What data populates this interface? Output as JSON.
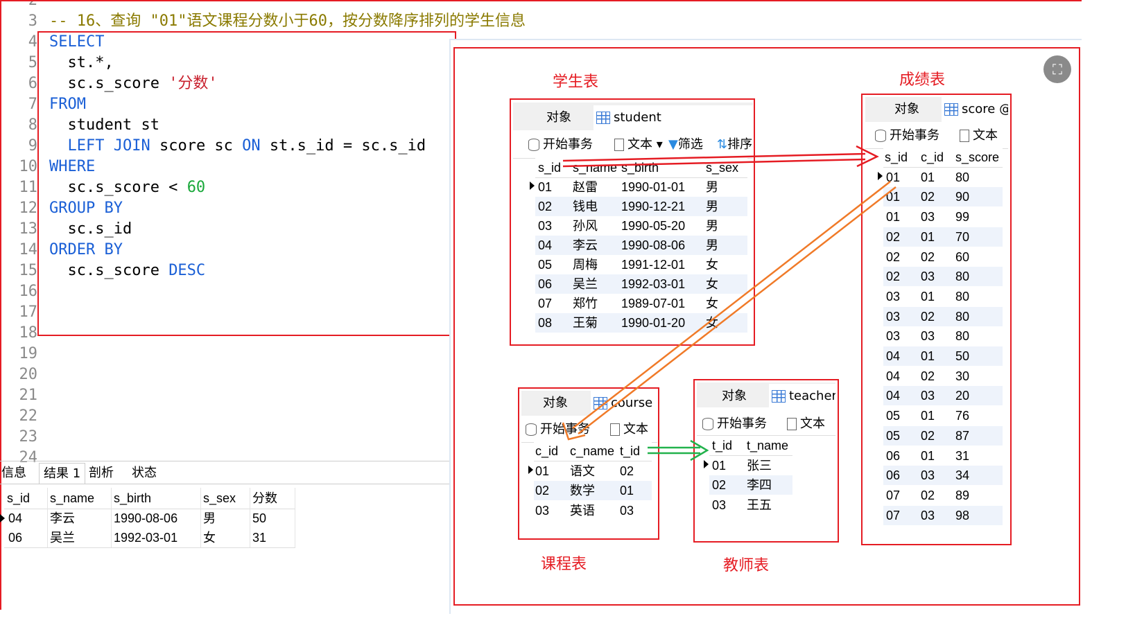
{
  "editor": {
    "lines": [
      "2",
      "3",
      "4",
      "5",
      "6",
      "7",
      "8",
      "9",
      "10",
      "11",
      "12",
      "13",
      "14",
      "15",
      "16",
      "17",
      "18",
      "19",
      "20",
      "21",
      "22",
      "23",
      "24"
    ],
    "comment": "-- 16、查询 \"01\"语文课程分数小于60，按分数降序排列的学生信息",
    "sql": {
      "l4": "SELECT",
      "l5": "  st.*,",
      "l6a": "  sc.s_score ",
      "l6b": "'分数'",
      "l7": "FROM",
      "l8": "  student st",
      "l9a": "  ",
      "l9b": "LEFT JOIN",
      "l9c": " score sc ",
      "l9d": "ON",
      "l9e": " st.s_id = sc.s_id",
      "l10": "WHERE",
      "l11a": "  sc.s_score < ",
      "l11b": "60",
      "l12": "GROUP BY",
      "l13": "  sc.s_id",
      "l14": "ORDER BY",
      "l15a": "  sc.s_score ",
      "l15b": "DESC"
    }
  },
  "result_panel": {
    "tabs": [
      "信息",
      "结果 1",
      "剖析",
      "状态"
    ],
    "columns": [
      "s_id",
      "s_name",
      "s_birth",
      "s_sex",
      "分数"
    ],
    "rows": [
      [
        "04",
        "李云",
        "1990-08-06",
        "男",
        "50"
      ],
      [
        "06",
        "吴兰",
        "1992-03-01",
        "女",
        "31"
      ]
    ]
  },
  "captions": {
    "student": "学生表",
    "score": "成绩表",
    "course": "课程表",
    "teacher": "教师表"
  },
  "student_window": {
    "tab_object": "对象",
    "tab_title": "student @mysql_test_2(",
    "toolbar": {
      "begin": "开始事务",
      "text": "文本",
      "filter": "筛选",
      "sort": "排序"
    },
    "columns": [
      "s_id",
      "s_name",
      "s_birth",
      "s_sex"
    ],
    "rows": [
      [
        "01",
        "赵雷",
        "1990-01-01",
        "男"
      ],
      [
        "02",
        "钱电",
        "1990-12-21",
        "男"
      ],
      [
        "03",
        "孙风",
        "1990-05-20",
        "男"
      ],
      [
        "04",
        "李云",
        "1990-08-06",
        "男"
      ],
      [
        "05",
        "周梅",
        "1991-12-01",
        "女"
      ],
      [
        "06",
        "吴兰",
        "1992-03-01",
        "女"
      ],
      [
        "07",
        "郑竹",
        "1989-07-01",
        "女"
      ],
      [
        "08",
        "王菊",
        "1990-01-20",
        "女"
      ]
    ]
  },
  "score_window": {
    "tab_object": "对象",
    "tab_title": "score @",
    "toolbar": {
      "begin": "开始事务",
      "text": "文本"
    },
    "columns": [
      "s_id",
      "c_id",
      "s_score"
    ],
    "rows": [
      [
        "01",
        "01",
        "80"
      ],
      [
        "01",
        "02",
        "90"
      ],
      [
        "01",
        "03",
        "99"
      ],
      [
        "02",
        "01",
        "70"
      ],
      [
        "02",
        "02",
        "60"
      ],
      [
        "02",
        "03",
        "80"
      ],
      [
        "03",
        "01",
        "80"
      ],
      [
        "03",
        "02",
        "80"
      ],
      [
        "03",
        "03",
        "80"
      ],
      [
        "04",
        "01",
        "50"
      ],
      [
        "04",
        "02",
        "30"
      ],
      [
        "04",
        "03",
        "20"
      ],
      [
        "05",
        "01",
        "76"
      ],
      [
        "05",
        "02",
        "87"
      ],
      [
        "06",
        "01",
        "31"
      ],
      [
        "06",
        "03",
        "34"
      ],
      [
        "07",
        "02",
        "89"
      ],
      [
        "07",
        "03",
        "98"
      ]
    ]
  },
  "course_window": {
    "tab_object": "对象",
    "tab_title": "course (",
    "toolbar": {
      "begin": "开始事务",
      "text": "文本"
    },
    "columns": [
      "c_id",
      "c_name",
      "t_id"
    ],
    "rows": [
      [
        "01",
        "语文",
        "02"
      ],
      [
        "02",
        "数学",
        "01"
      ],
      [
        "03",
        "英语",
        "03"
      ]
    ]
  },
  "teacher_window": {
    "tab_object": "对象",
    "tab_title": "teacher",
    "toolbar": {
      "begin": "开始事务",
      "text": "文本"
    },
    "columns": [
      "t_id",
      "t_name"
    ],
    "rows": [
      [
        "01",
        "张三"
      ],
      [
        "02",
        "李四"
      ],
      [
        "03",
        "王五"
      ]
    ]
  },
  "colors": {
    "annotation_red": "#e51c23",
    "arrow_orange": "#f07a28",
    "arrow_green": "#22b24c",
    "keyword_blue": "#1a5fd6"
  },
  "icons": {
    "close": "close-circle-icon"
  }
}
